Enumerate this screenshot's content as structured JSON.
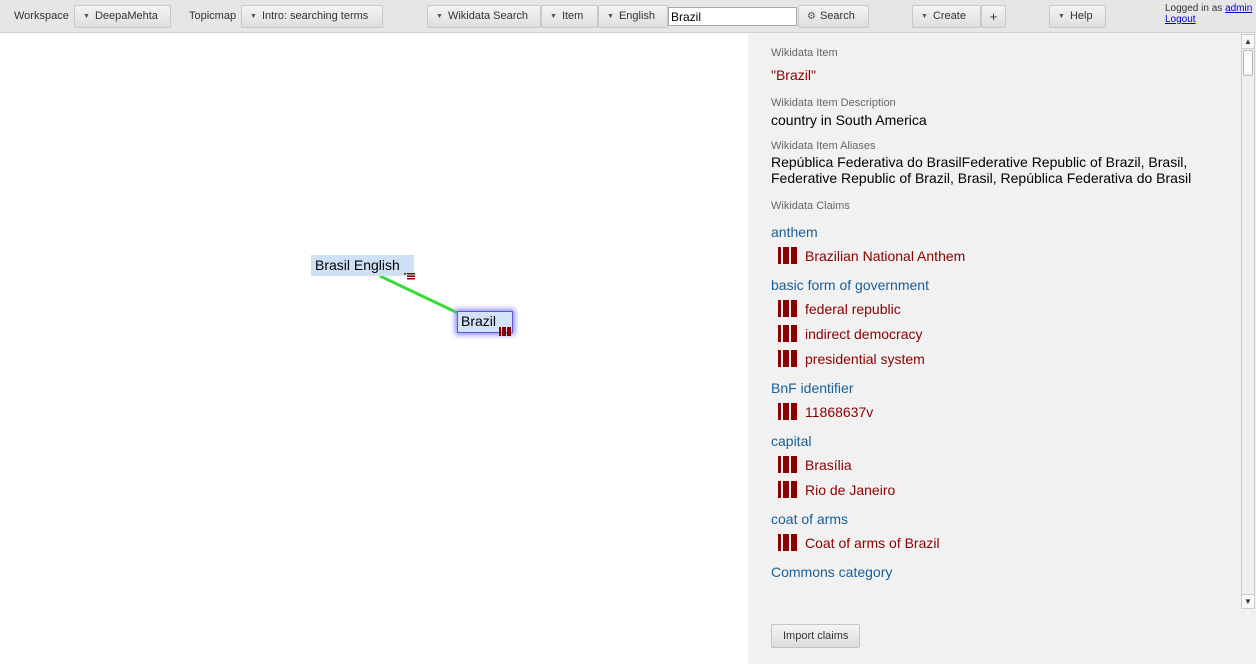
{
  "toolbar": {
    "workspace_label": "Workspace",
    "workspace_value": "DeepaMehta",
    "topicmap_label": "Topicmap",
    "topicmap_value": "Intro: searching terms",
    "search_type": "Wikidata Search",
    "search_kind": "Item",
    "language": "English",
    "search_value": "Brazil",
    "search_button": "Search",
    "create_button": "Create",
    "add_button": "+",
    "help_button": "Help",
    "logged_in_text": "Logged in as",
    "user_link": "admin",
    "logout_link": "Logout"
  },
  "topicmap": {
    "nodes": [
      {
        "label": "Brasil English",
        "icon": "note-icon"
      },
      {
        "label": "Brazil",
        "icon": "wikidata-item-icon",
        "selected": true
      }
    ],
    "edge_color": "#33dd33"
  },
  "detail": {
    "item_label": "Wikidata Item",
    "item_value": "\"Brazil\"",
    "description_label": "Wikidata Item Description",
    "description_value": "country in South America",
    "aliases_label": "Wikidata Item Aliases",
    "aliases_value": "República Federativa do BrasilFederative Republic of Brazil, Brasil, Federative Republic of Brazil, Brasil, República Federativa do Brasil",
    "claims_label": "Wikidata Claims",
    "claims": [
      {
        "property": "anthem",
        "values": [
          "Brazilian National Anthem"
        ]
      },
      {
        "property": "basic form of government",
        "values": [
          "federal republic",
          "indirect democracy",
          "presidential system"
        ]
      },
      {
        "property": "BnF identifier",
        "values": [
          "11868637v"
        ]
      },
      {
        "property": "capital",
        "values": [
          "Brasília",
          "Rio de Janeiro"
        ]
      },
      {
        "property": "coat of arms",
        "values": [
          "Coat of arms of Brazil"
        ]
      },
      {
        "property": "Commons category",
        "values": []
      }
    ],
    "import_button": "Import claims"
  },
  "colors": {
    "property_link": "#1a5e96",
    "item_link": "#8b0000",
    "topic_bg": "#cfe0f4",
    "panel_bg": "#f1f1f1",
    "toolbar_bg": "#e6e6e6"
  }
}
